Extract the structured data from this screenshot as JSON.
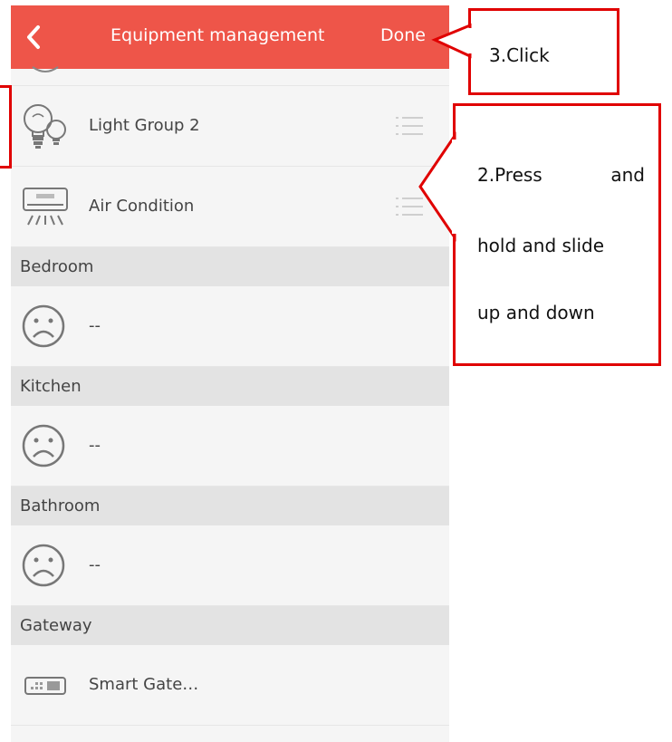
{
  "header": {
    "back_icon": "chevron-left-icon",
    "title": "Equipment management",
    "done_label": "Done",
    "background_color": "#ee5549"
  },
  "items": [
    {
      "type": "device",
      "label": "Light Group 2",
      "icon": "light-bulb-icon",
      "drag_handle": "drag-handle-icon"
    },
    {
      "type": "device",
      "label": "Air Condition",
      "icon": "air-conditioner-icon",
      "drag_handle": "drag-handle-icon"
    },
    {
      "type": "section",
      "label": "Bedroom"
    },
    {
      "type": "empty",
      "label": "--",
      "icon": "sad-face-icon"
    },
    {
      "type": "section",
      "label": "Kitchen"
    },
    {
      "type": "empty",
      "label": "--",
      "icon": "sad-face-icon"
    },
    {
      "type": "section",
      "label": "Bathroom"
    },
    {
      "type": "empty",
      "label": "--",
      "icon": "sad-face-icon"
    },
    {
      "type": "section",
      "label": "Gateway"
    },
    {
      "type": "device",
      "label": "Smart Gate…",
      "icon": "gateway-icon"
    }
  ],
  "annotations": {
    "click_note": "3.Click",
    "press_note_line1_a": "2.Press",
    "press_note_line1_b": "and",
    "press_note_line2": "hold and slide",
    "press_note_line3": "up and down",
    "border_color": "#e00000"
  }
}
